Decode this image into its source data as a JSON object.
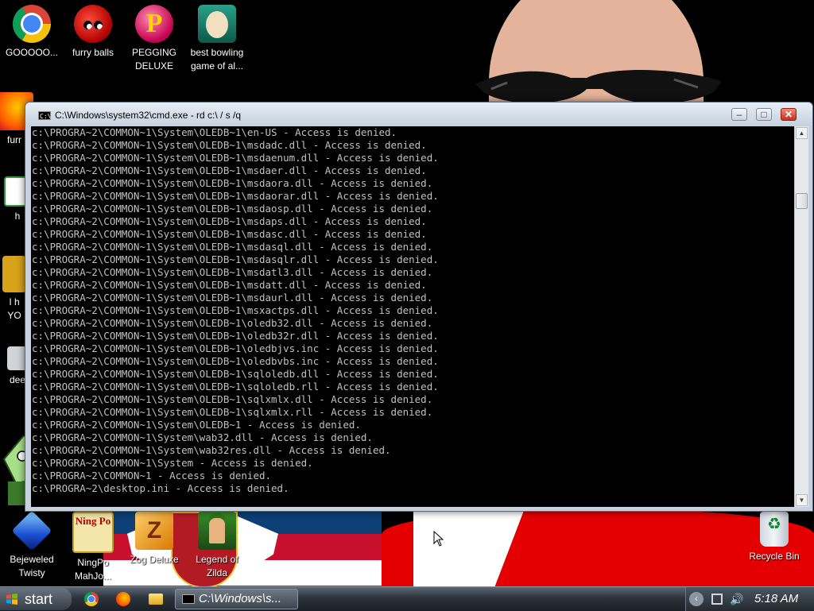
{
  "desktop": {
    "icons": [
      {
        "label": "GOOOOO...",
        "icon": "chrome-icon"
      },
      {
        "label": "furry balls",
        "icon": "furry-balls-icon"
      },
      {
        "label": "PEGGING DELUXE",
        "icon": "pegging-deluxe-icon",
        "glyph": "P"
      },
      {
        "label": "best bowling game of al...",
        "icon": "bowling-game-icon"
      },
      {
        "label": "Bejeweled Twisty",
        "icon": "gem-icon"
      },
      {
        "label": "NingPo MahJo...",
        "icon": "mahjong-icon",
        "glyph": "Ning Po"
      },
      {
        "label": "Zog Deluxe",
        "icon": "zog-icon",
        "glyph": "Z"
      },
      {
        "label": "Legend of Zilda",
        "icon": "zelda-icon"
      },
      {
        "label": "Recycle Bin",
        "icon": "recycle-bin-icon"
      }
    ],
    "partial_icons": [
      {
        "label": "furr",
        "icon": "firefox-icon"
      },
      {
        "label": "h",
        "icon": "app-icon"
      },
      {
        "label": "I h",
        "icon": "app-icon"
      },
      {
        "label": "YO",
        "icon": "app-icon"
      },
      {
        "label": "dee",
        "icon": "app-icon"
      }
    ]
  },
  "window": {
    "title": "C:\\Windows\\system32\\cmd.exe - rd  c:\\ / s /q",
    "icon_glyph": "C:\\",
    "buttons": {
      "minimize": "–",
      "maximize": "□",
      "close": "✕"
    },
    "console_lines": [
      "c:\\PROGRA~2\\COMMON~1\\System\\OLEDB~1\\en-US - Access is denied.",
      "c:\\PROGRA~2\\COMMON~1\\System\\OLEDB~1\\msdadc.dll - Access is denied.",
      "c:\\PROGRA~2\\COMMON~1\\System\\OLEDB~1\\msdaenum.dll - Access is denied.",
      "c:\\PROGRA~2\\COMMON~1\\System\\OLEDB~1\\msdaer.dll - Access is denied.",
      "c:\\PROGRA~2\\COMMON~1\\System\\OLEDB~1\\msdaora.dll - Access is denied.",
      "c:\\PROGRA~2\\COMMON~1\\System\\OLEDB~1\\msdaorar.dll - Access is denied.",
      "c:\\PROGRA~2\\COMMON~1\\System\\OLEDB~1\\msdaosp.dll - Access is denied.",
      "c:\\PROGRA~2\\COMMON~1\\System\\OLEDB~1\\msdaps.dll - Access is denied.",
      "c:\\PROGRA~2\\COMMON~1\\System\\OLEDB~1\\msdasc.dll - Access is denied.",
      "c:\\PROGRA~2\\COMMON~1\\System\\OLEDB~1\\msdasql.dll - Access is denied.",
      "c:\\PROGRA~2\\COMMON~1\\System\\OLEDB~1\\msdasqlr.dll - Access is denied.",
      "c:\\PROGRA~2\\COMMON~1\\System\\OLEDB~1\\msdatl3.dll - Access is denied.",
      "c:\\PROGRA~2\\COMMON~1\\System\\OLEDB~1\\msdatt.dll - Access is denied.",
      "c:\\PROGRA~2\\COMMON~1\\System\\OLEDB~1\\msdaurl.dll - Access is denied.",
      "c:\\PROGRA~2\\COMMON~1\\System\\OLEDB~1\\msxactps.dll - Access is denied.",
      "c:\\PROGRA~2\\COMMON~1\\System\\OLEDB~1\\oledb32.dll - Access is denied.",
      "c:\\PROGRA~2\\COMMON~1\\System\\OLEDB~1\\oledb32r.dll - Access is denied.",
      "c:\\PROGRA~2\\COMMON~1\\System\\OLEDB~1\\oledbjvs.inc - Access is denied.",
      "c:\\PROGRA~2\\COMMON~1\\System\\OLEDB~1\\oledbvbs.inc - Access is denied.",
      "c:\\PROGRA~2\\COMMON~1\\System\\OLEDB~1\\sqloledb.dll - Access is denied.",
      "c:\\PROGRA~2\\COMMON~1\\System\\OLEDB~1\\sqloledb.rll - Access is denied.",
      "c:\\PROGRA~2\\COMMON~1\\System\\OLEDB~1\\sqlxmlx.dll - Access is denied.",
      "c:\\PROGRA~2\\COMMON~1\\System\\OLEDB~1\\sqlxmlx.rll - Access is denied.",
      "c:\\PROGRA~2\\COMMON~1\\System\\OLEDB~1 - Access is denied.",
      "c:\\PROGRA~2\\COMMON~1\\System\\wab32.dll - Access is denied.",
      "c:\\PROGRA~2\\COMMON~1\\System\\wab32res.dll - Access is denied.",
      "c:\\PROGRA~2\\COMMON~1\\System - Access is denied.",
      "c:\\PROGRA~2\\COMMON~1 - Access is denied.",
      "c:\\PROGRA~2\\desktop.ini - Access is denied."
    ],
    "scrollbar": {
      "up": "▲",
      "down": "▼"
    }
  },
  "taskbar": {
    "start_label": "start",
    "quick_launch": [
      "chrome-icon",
      "firefox-icon",
      "folder-icon"
    ],
    "tasks": [
      {
        "label": "C:\\Windows\\s...",
        "icon": "cmd-icon"
      }
    ],
    "tray": {
      "chevron": "‹",
      "volume_glyph": "🔊",
      "clock": "5:18 AM"
    }
  },
  "colors": {
    "console_bg": "#000000",
    "console_text": "#c0c0c0",
    "close_button": "#c2321f",
    "wallpaper_red": "#e40000"
  }
}
